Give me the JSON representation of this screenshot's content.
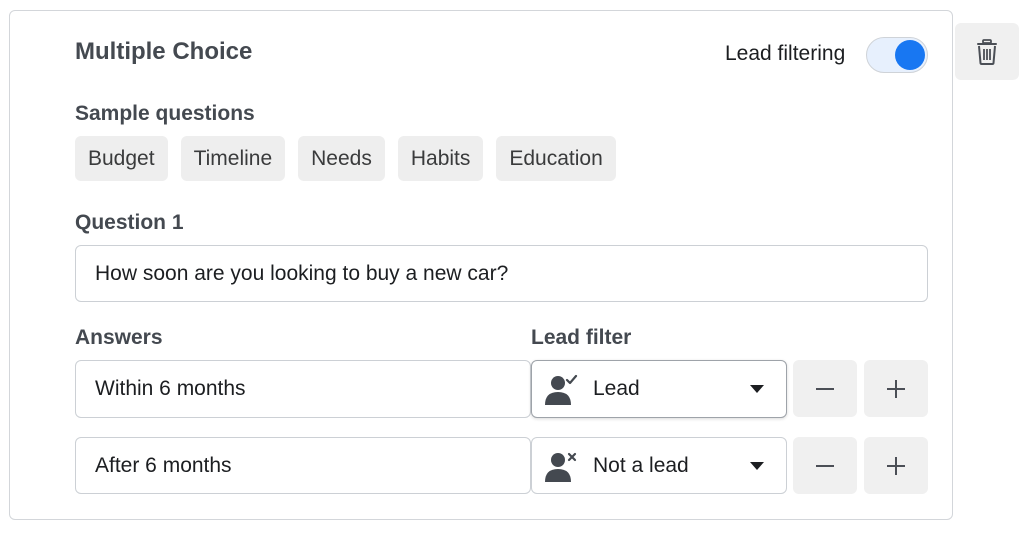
{
  "card": {
    "title": "Multiple Choice",
    "lead_filtering_label": "Lead filtering",
    "lead_filtering_on": true,
    "delete_icon": "trash-icon"
  },
  "sample_questions": {
    "label": "Sample questions",
    "chips": [
      "Budget",
      "Timeline",
      "Needs",
      "Habits",
      "Education"
    ]
  },
  "question": {
    "label": "Question 1",
    "value": "How soon are you looking to buy a new car?"
  },
  "answers": {
    "label": "Answers",
    "lead_filter_label": "Lead filter",
    "rows": [
      {
        "answer": "Within 6 months",
        "filter": "Lead",
        "filter_icon": "user-check-icon"
      },
      {
        "answer": "After 6 months",
        "filter": "Not a lead",
        "filter_icon": "user-x-icon"
      }
    ],
    "remove_icon": "minus-icon",
    "add_icon": "plus-icon"
  },
  "colors": {
    "accent": "#1877f2",
    "toggle_track": "#e7f0fd",
    "button_bg": "#f0f0f0"
  }
}
